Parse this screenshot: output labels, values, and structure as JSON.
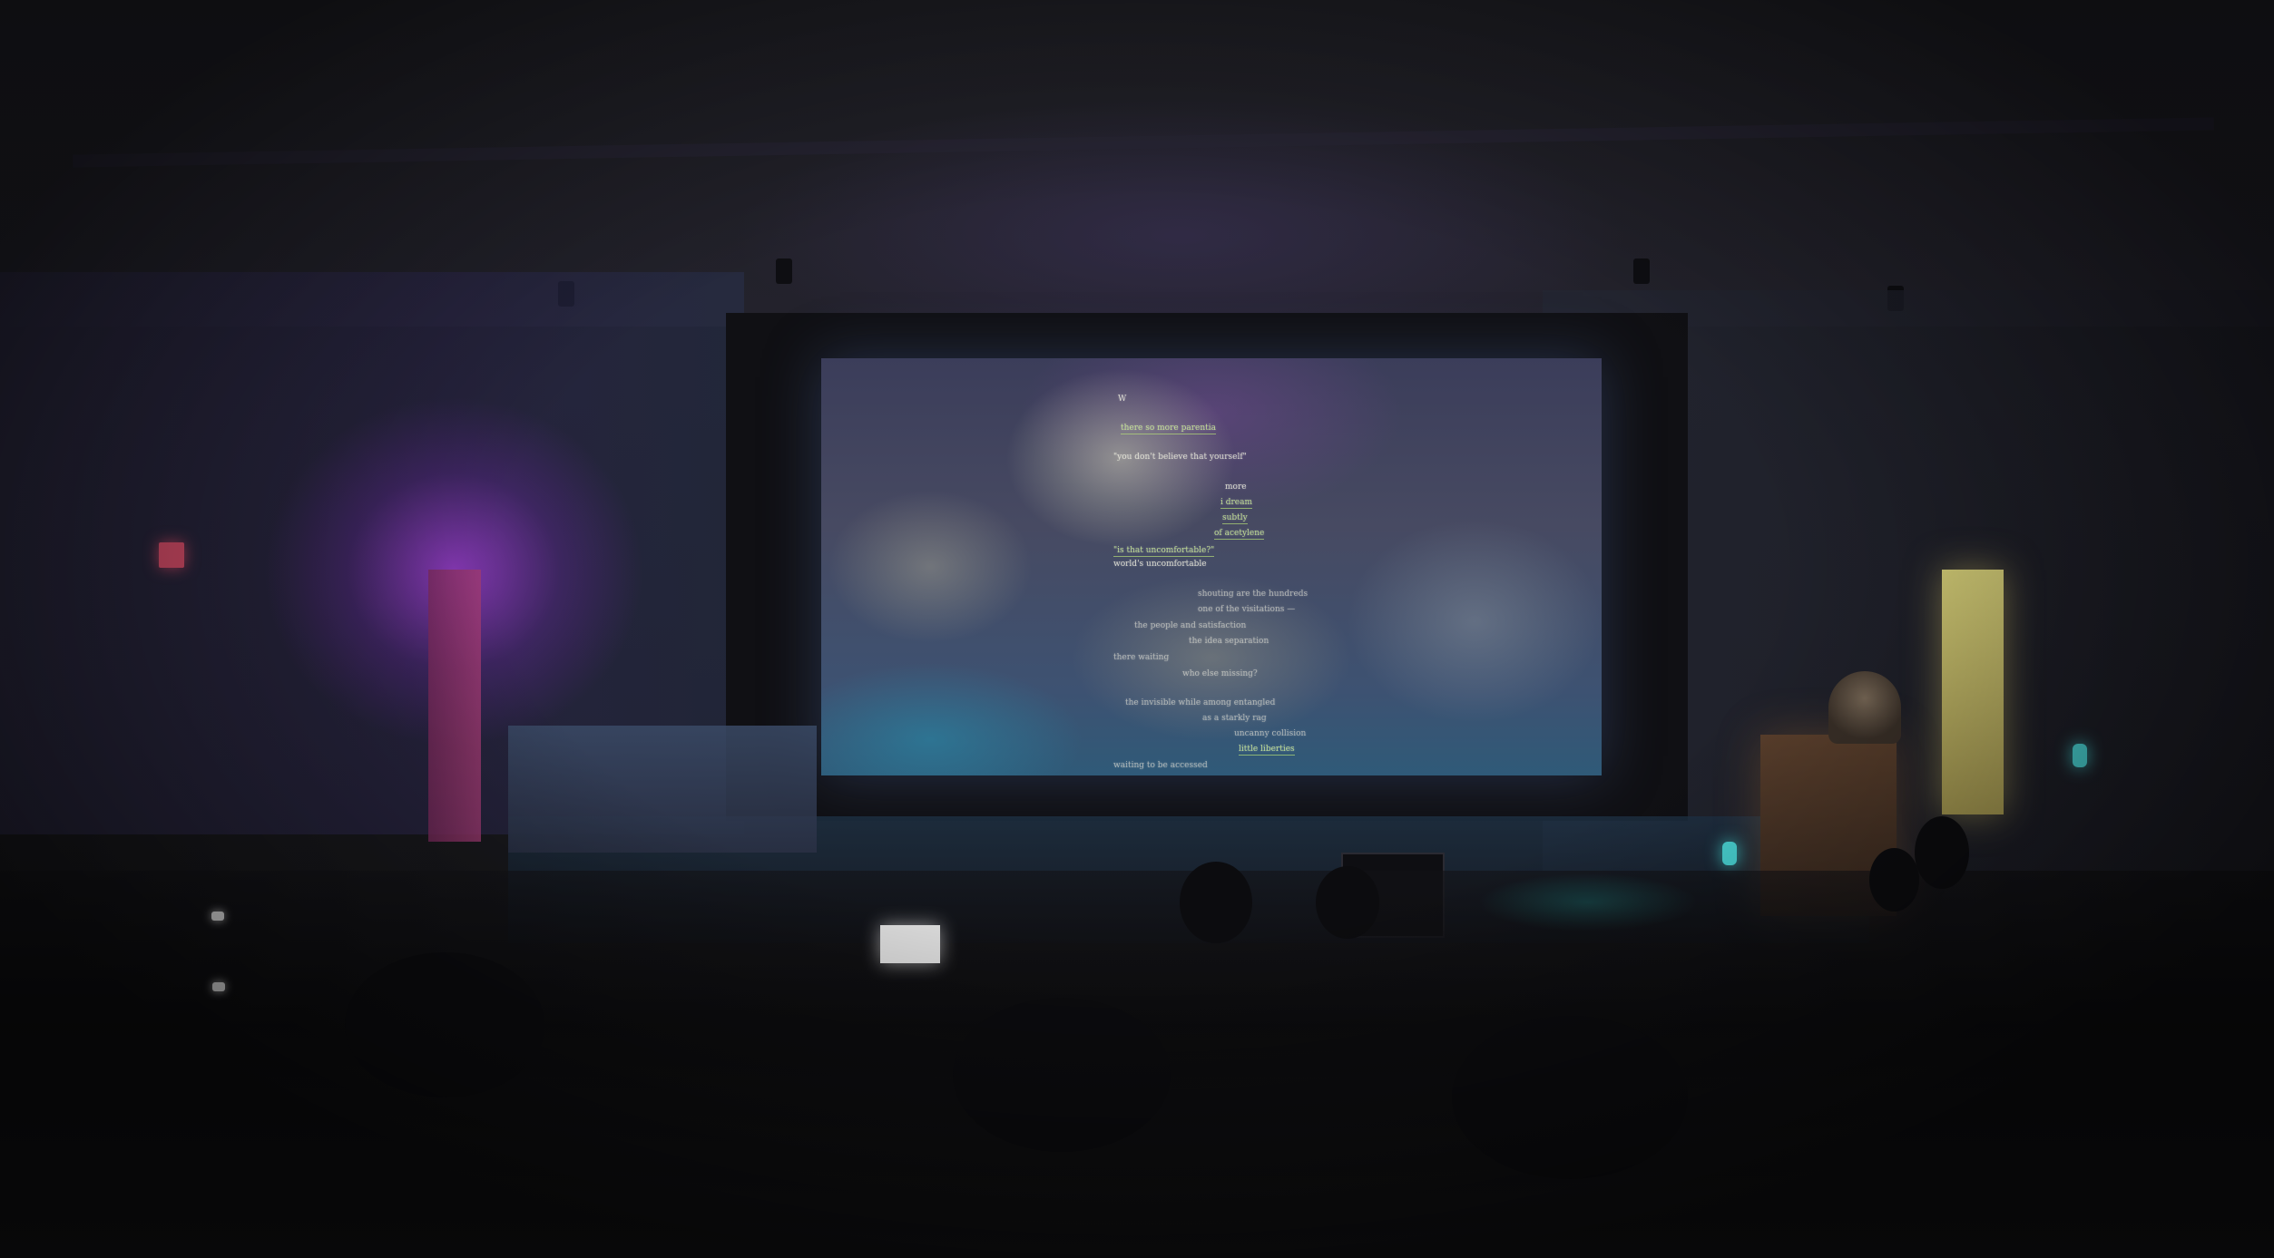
{
  "scene": {
    "setting": "dark auditorium with projection screen"
  },
  "screen_text": {
    "lines": [
      {
        "text": "W",
        "style": "normal"
      },
      {
        "text": "there    so    more   parentia",
        "style": "green"
      },
      {
        "text": "\"you don't believe that yourself\"",
        "style": "normal"
      },
      {
        "text": "more",
        "style": "normal"
      },
      {
        "text": "i dream",
        "style": "green"
      },
      {
        "text": "subtly",
        "style": "green"
      },
      {
        "text": "of acetylene",
        "style": "green"
      },
      {
        "text": "\"is that uncomfortable?\"",
        "style": "green"
      },
      {
        "text": "world's uncomfortable",
        "style": "normal"
      },
      {
        "text": "shouting are the hundreds",
        "style": "dim"
      },
      {
        "text": "one of the visitations —",
        "style": "dim"
      },
      {
        "text": "the people and satisfaction",
        "style": "dim"
      },
      {
        "text": "the idea separation",
        "style": "dim"
      },
      {
        "text": "there waiting",
        "style": "dim"
      },
      {
        "text": "who else missing?",
        "style": "dim"
      },
      {
        "text": "the invisible while among    entangled",
        "style": "dim"
      },
      {
        "text": "as a starkly rag",
        "style": "dim"
      },
      {
        "text": "uncanny collision",
        "style": "dim"
      },
      {
        "text": "little liberties",
        "style": "green"
      },
      {
        "text": "waiting to be accessed",
        "style": "dim"
      }
    ]
  }
}
